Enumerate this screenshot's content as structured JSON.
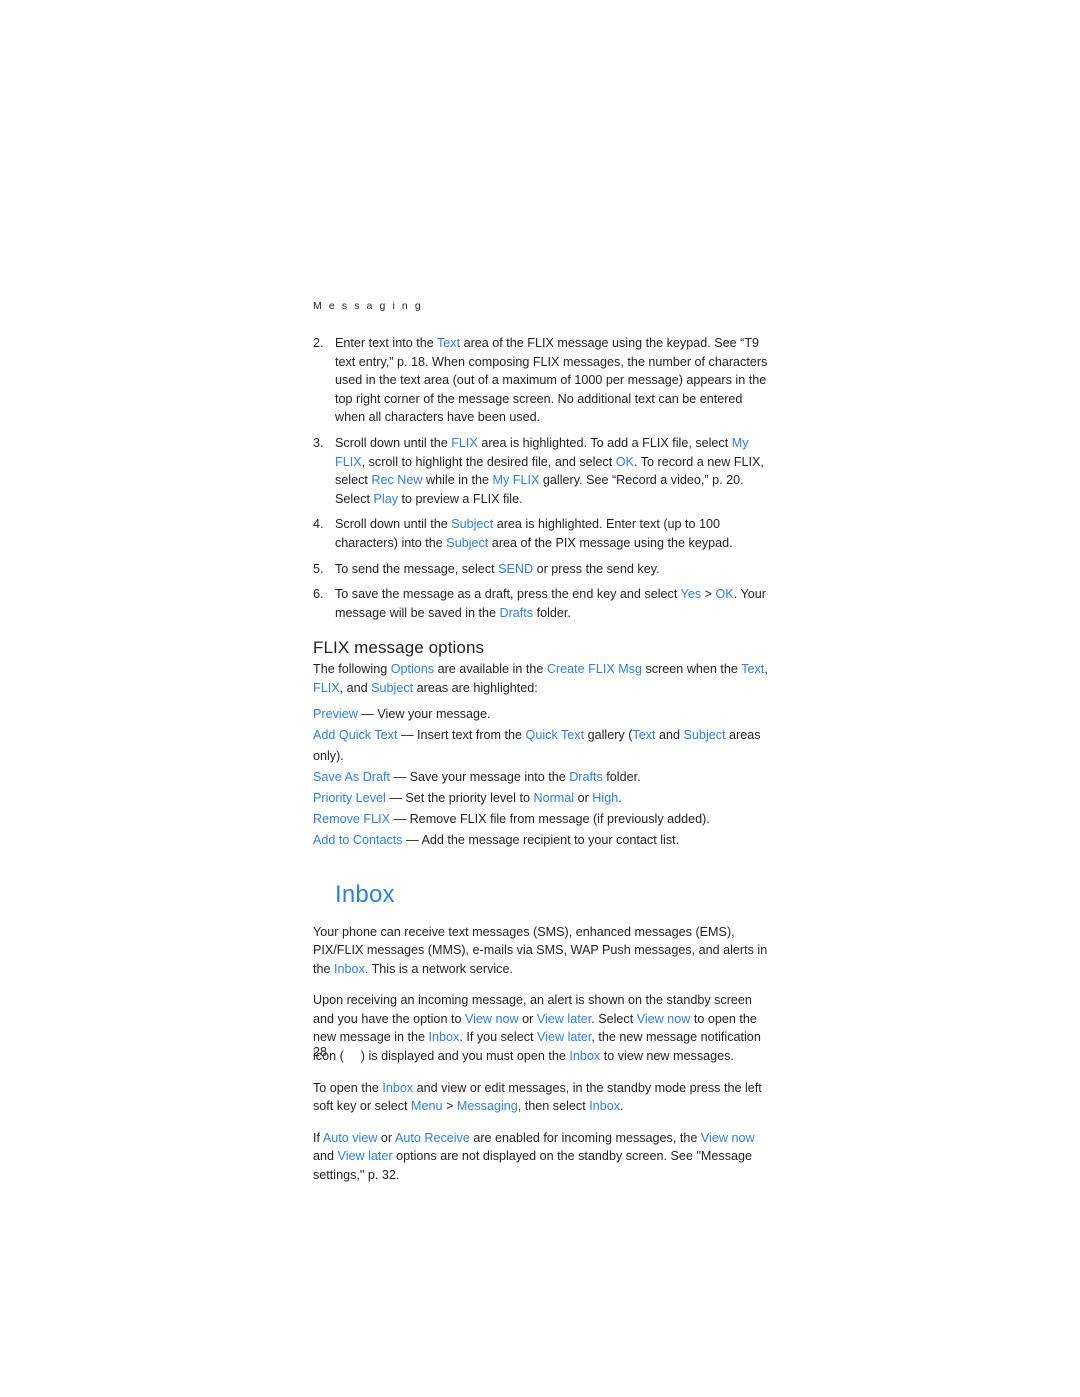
{
  "page": {
    "running_head": "M e s s a g i n g",
    "folio": "28",
    "accent_color": "#2b7fe8",
    "text_color": "#231f20"
  },
  "steps": [
    {
      "number": "2.",
      "parts": [
        {
          "t": "Enter text into the ",
          "k": false
        },
        {
          "t": "Text",
          "k": true
        },
        {
          "t": " area of the FLIX message using the keypad. See “T9 text entry,” p. 18. When composing FLIX messages, the number of characters used in the text area (out of a maximum of 1000 per message) appears in the top right corner of the message screen. No additional text can be entered when all characters have been used.",
          "k": false
        }
      ]
    },
    {
      "number": "3.",
      "parts": [
        {
          "t": "Scroll down until the ",
          "k": false
        },
        {
          "t": "FLIX",
          "k": true
        },
        {
          "t": " area is highlighted. To add a FLIX file, select ",
          "k": false
        },
        {
          "t": "My FLIX",
          "k": true
        },
        {
          "t": ", scroll to highlight the desired file, and select ",
          "k": false
        },
        {
          "t": "OK",
          "k": true
        },
        {
          "t": ". To record a new FLIX, select ",
          "k": false
        },
        {
          "t": "Rec New",
          "k": true
        },
        {
          "t": " while in the ",
          "k": false
        },
        {
          "t": "My FLIX",
          "k": true
        },
        {
          "t": " gallery. See “Record a video,” p. 20. Select ",
          "k": false
        },
        {
          "t": "Play",
          "k": true
        },
        {
          "t": " to preview a FLIX file.",
          "k": false
        }
      ]
    },
    {
      "number": "4.",
      "parts": [
        {
          "t": "Scroll down until the ",
          "k": false
        },
        {
          "t": "Subject",
          "k": true
        },
        {
          "t": " area is highlighted. Enter text (up to 100 characters) into the ",
          "k": false
        },
        {
          "t": "Subject",
          "k": true
        },
        {
          "t": " area of the PIX message using the keypad.",
          "k": false
        }
      ]
    },
    {
      "number": "5.",
      "parts": [
        {
          "t": "To send the message, select ",
          "k": false
        },
        {
          "t": "SEND",
          "k": true
        },
        {
          "t": " or press the send key.",
          "k": false
        }
      ]
    },
    {
      "number": "6.",
      "parts": [
        {
          "t": "To save the message as a draft, press the end key and select ",
          "k": false
        },
        {
          "t": "Yes",
          "k": true
        },
        {
          "t": " > ",
          "k": false
        },
        {
          "t": "OK",
          "k": true
        },
        {
          "t": ". Your message will be saved in the ",
          "k": false
        },
        {
          "t": "Drafts",
          "k": true
        },
        {
          "t": " folder.",
          "k": false
        }
      ]
    }
  ],
  "flix_options_section": {
    "title": "FLIX message options",
    "intro_parts": [
      {
        "t": "The following ",
        "k": false
      },
      {
        "t": "Options",
        "k": true
      },
      {
        "t": " are available in the ",
        "k": false
      },
      {
        "t": "Create FLIX Msg",
        "k": true
      },
      {
        "t": " screen when the ",
        "k": false
      },
      {
        "t": "Text",
        "k": true
      },
      {
        "t": ", ",
        "k": false
      },
      {
        "t": "FLIX",
        "k": true
      },
      {
        "t": ", and ",
        "k": false
      },
      {
        "t": "Subject",
        "k": true
      },
      {
        "t": " areas are highlighted:",
        "k": false
      }
    ],
    "options": [
      {
        "label": "Preview",
        "parts": [
          {
            "t": "Preview",
            "k": true
          },
          {
            "t": " — View your message.",
            "k": false
          }
        ]
      },
      {
        "label": "Add Quick Text",
        "parts": [
          {
            "t": "Add Quick Text",
            "k": true
          },
          {
            "t": " — Insert text from the ",
            "k": false
          },
          {
            "t": "Quick Text",
            "k": true
          },
          {
            "t": " gallery (",
            "k": false
          },
          {
            "t": "Text",
            "k": true
          },
          {
            "t": " and ",
            "k": false
          },
          {
            "t": "Subject",
            "k": true
          },
          {
            "t": " areas only).",
            "k": false
          }
        ]
      },
      {
        "label": "Save As Draft",
        "parts": [
          {
            "t": "Save As Draft",
            "k": true
          },
          {
            "t": " — Save your message into the ",
            "k": false
          },
          {
            "t": "Drafts",
            "k": true
          },
          {
            "t": " folder.",
            "k": false
          }
        ]
      },
      {
        "label": "Priority Level",
        "parts": [
          {
            "t": "Priority Level",
            "k": true
          },
          {
            "t": " — Set the priority level to ",
            "k": false
          },
          {
            "t": "Normal",
            "k": true
          },
          {
            "t": " or ",
            "k": false
          },
          {
            "t": "High",
            "k": true
          },
          {
            "t": ".",
            "k": false
          }
        ]
      },
      {
        "label": "Remove FLIX",
        "parts": [
          {
            "t": "Remove FLIX",
            "k": true
          },
          {
            "t": " — Remove FLIX file from message (if previously added).",
            "k": false
          }
        ]
      },
      {
        "label": "Add to Contacts",
        "parts": [
          {
            "t": "Add to Contacts",
            "k": true
          },
          {
            "t": " — Add the message recipient to your contact list.",
            "k": false
          }
        ]
      }
    ]
  },
  "inbox_section": {
    "title": "Inbox",
    "paragraphs": [
      {
        "parts": [
          {
            "t": "Your phone can receive text messages (SMS), enhanced messages (EMS), PIX/FLIX messages (MMS), e-mails via SMS, WAP Push messages, and alerts in the ",
            "k": false
          },
          {
            "t": "Inbox",
            "k": true
          },
          {
            "t": ". This is a network service.",
            "k": false
          }
        ]
      },
      {
        "parts": [
          {
            "t": "Upon receiving an incoming message, an alert is shown on the standby screen and you have the option to ",
            "k": false
          },
          {
            "t": "View now",
            "k": true
          },
          {
            "t": " or ",
            "k": false
          },
          {
            "t": "View later",
            "k": true
          },
          {
            "t": ". Select ",
            "k": false
          },
          {
            "t": "View now",
            "k": true
          },
          {
            "t": " to open the new message in the ",
            "k": false
          },
          {
            "t": "Inbox",
            "k": true
          },
          {
            "t": ". If you select ",
            "k": false
          },
          {
            "t": "View later",
            "k": true
          },
          {
            "t": ", the new message notification icon (",
            "k": false
          },
          {
            "t": "ICON_GAP",
            "k": false
          },
          {
            "t": ") is displayed and you must open the ",
            "k": false
          },
          {
            "t": "Inbox",
            "k": true
          },
          {
            "t": " to view new messages.",
            "k": false
          }
        ]
      },
      {
        "parts": [
          {
            "t": "To open the ",
            "k": false
          },
          {
            "t": "Inbox",
            "k": true
          },
          {
            "t": " and view or edit messages, in the standby mode press the left soft key or select ",
            "k": false
          },
          {
            "t": "Menu",
            "k": true
          },
          {
            "t": " > ",
            "k": false
          },
          {
            "t": "Messaging",
            "k": true
          },
          {
            "t": ", then select ",
            "k": false
          },
          {
            "t": "Inbox",
            "k": true
          },
          {
            "t": ".",
            "k": false
          }
        ]
      },
      {
        "parts": [
          {
            "t": "If ",
            "k": false
          },
          {
            "t": "Auto view",
            "k": true
          },
          {
            "t": " or ",
            "k": false
          },
          {
            "t": "Auto Receive",
            "k": true
          },
          {
            "t": " are enabled for incoming messages, the ",
            "k": false
          },
          {
            "t": "View now",
            "k": true
          },
          {
            "t": " and ",
            "k": false
          },
          {
            "t": "View later",
            "k": true
          },
          {
            "t": " options are not displayed on the standby screen. See \"Message settings,\" p. 32.",
            "k": false
          }
        ]
      }
    ]
  }
}
